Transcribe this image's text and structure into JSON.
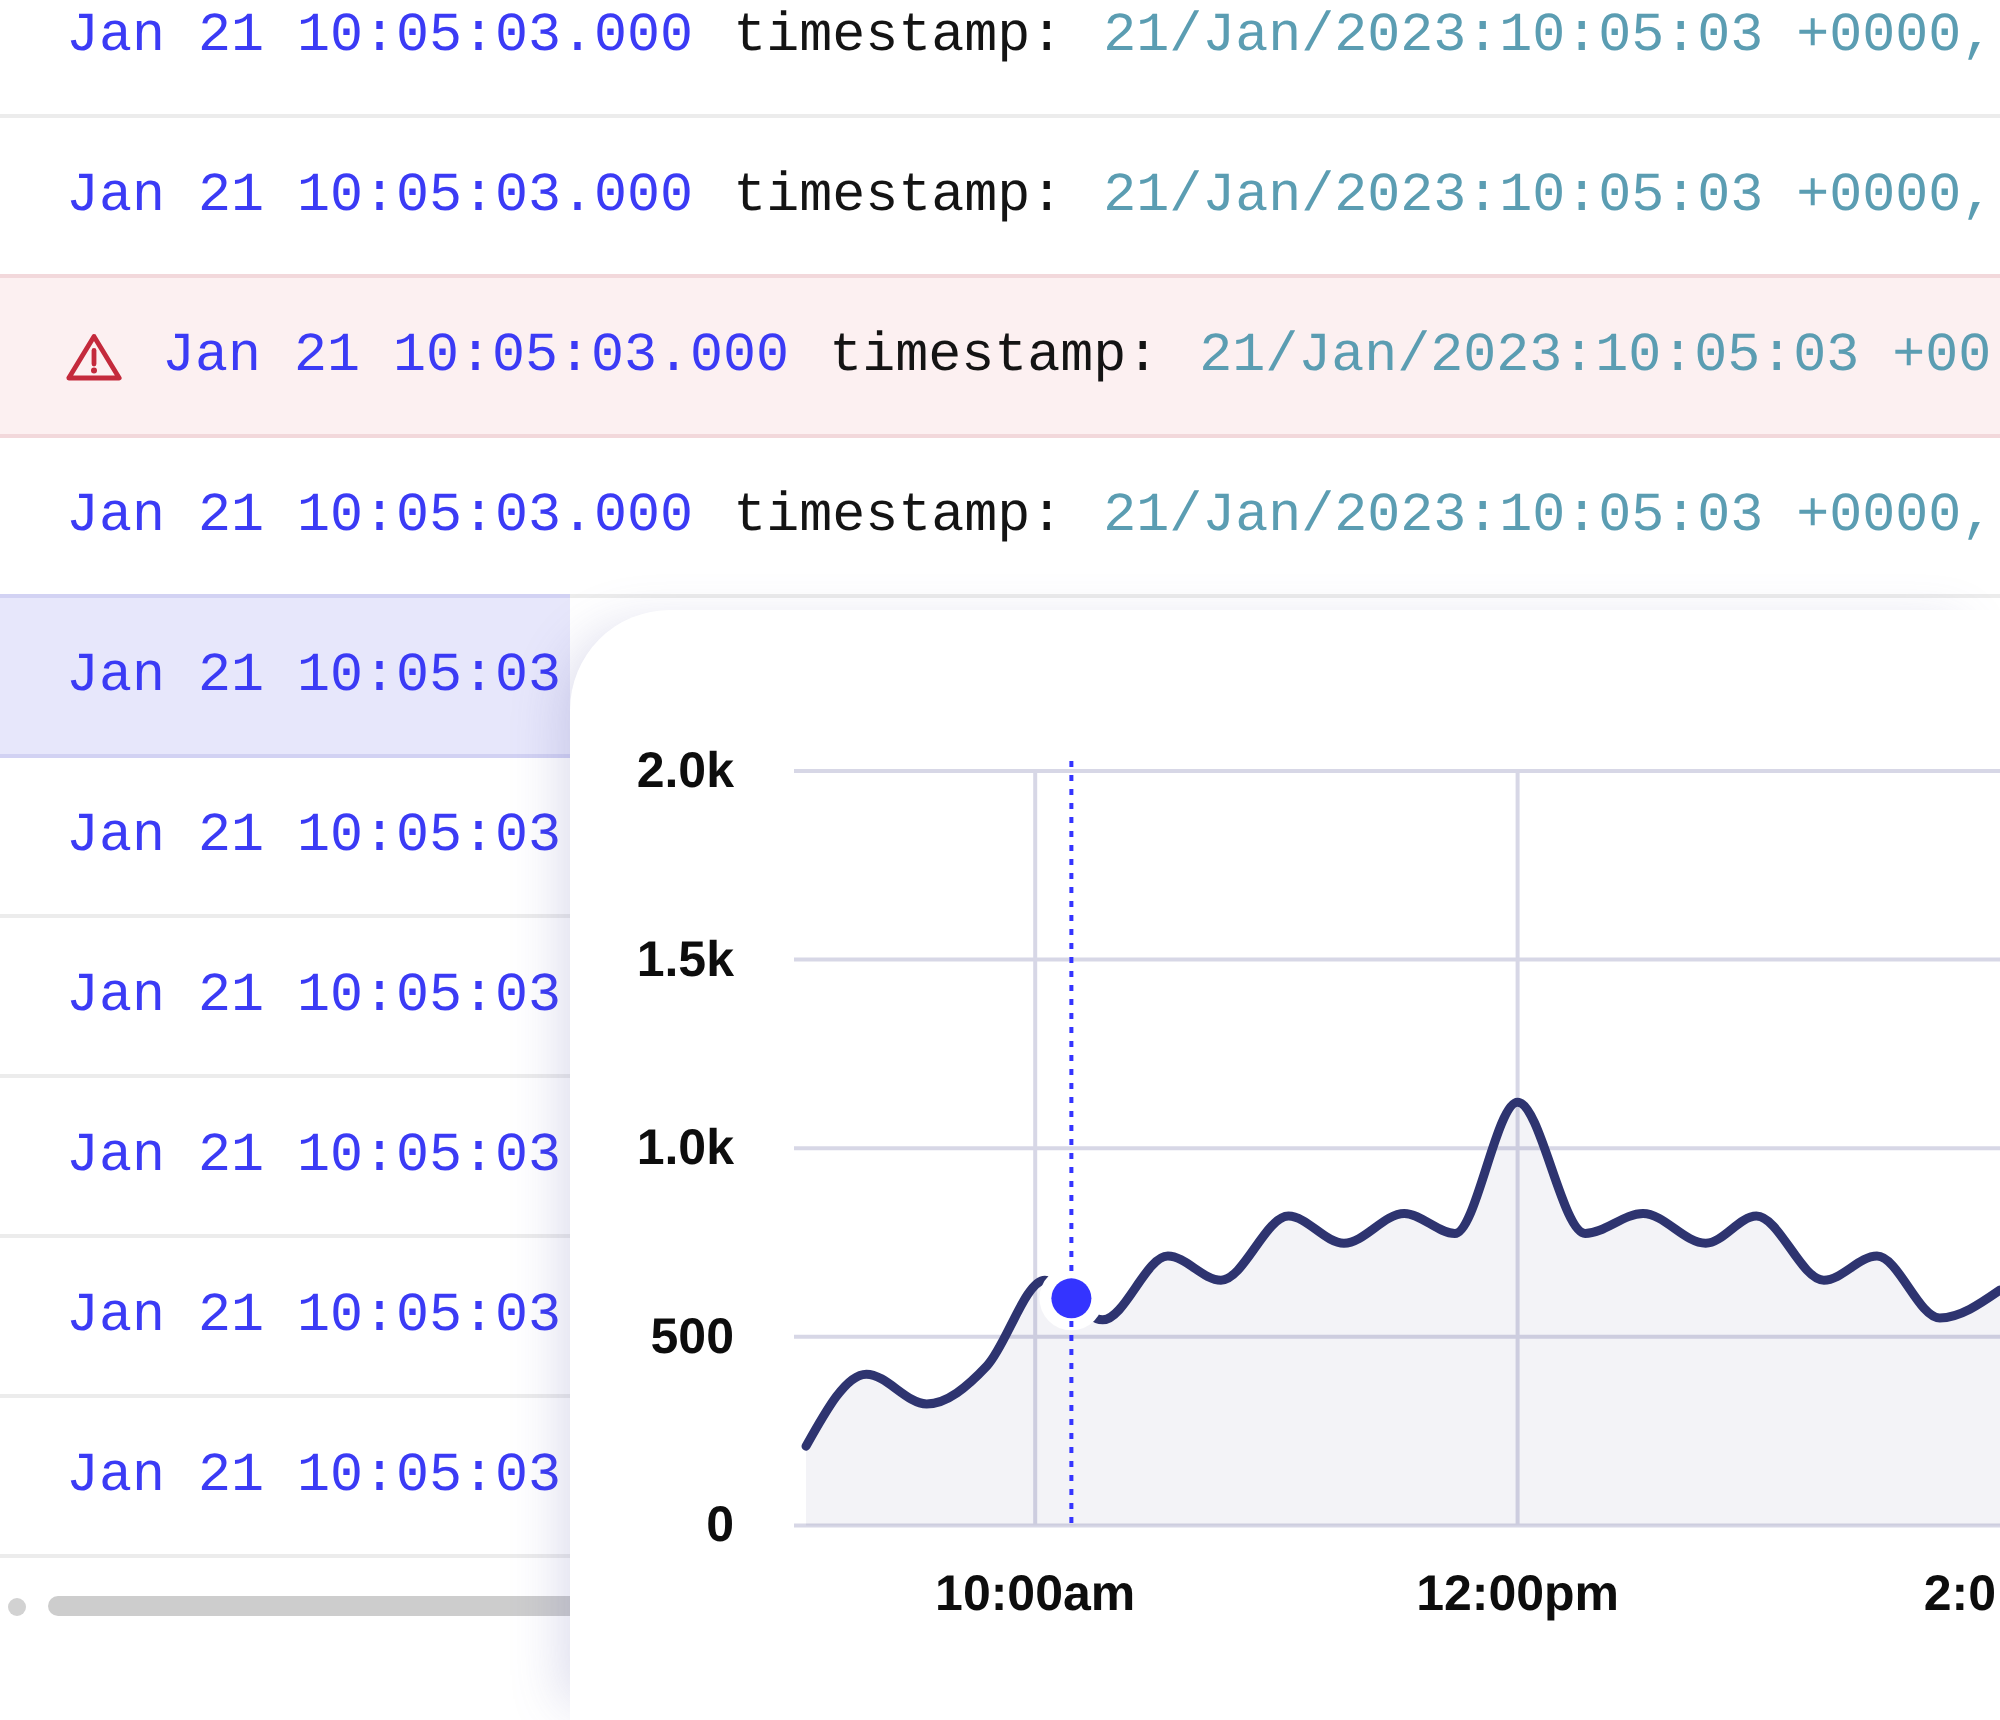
{
  "log": {
    "rows": [
      {
        "time": "Jan 21 10:05:03.000",
        "key": "timestamp:",
        "value": "21/Jan/2023:10:05:03 +0000,",
        "kind": "normal",
        "selected": false
      },
      {
        "time": "Jan 21 10:05:03.000",
        "key": "timestamp:",
        "value": "21/Jan/2023:10:05:03 +0000,",
        "kind": "normal",
        "selected": false
      },
      {
        "time": "Jan 21 10:05:03.000",
        "key": "timestamp:",
        "value": "21/Jan/2023:10:05:03 +00",
        "kind": "warning",
        "selected": false
      },
      {
        "time": "Jan 21 10:05:03.000",
        "key": "timestamp:",
        "value": "21/Jan/2023:10:05:03 +0000,",
        "kind": "normal",
        "selected": false
      },
      {
        "time": "Jan 21 10:05:03",
        "kind": "normal",
        "selected": true
      },
      {
        "time": "Jan 21 10:05:03",
        "kind": "normal",
        "selected": false
      },
      {
        "time": "Jan 21 10:05:03",
        "kind": "normal",
        "selected": false
      },
      {
        "time": "Jan 21 10:05:03",
        "kind": "normal",
        "selected": false
      },
      {
        "time": "Jan 21 10:05:03",
        "kind": "normal",
        "selected": false
      },
      {
        "time": "Jan 21 10:05:03",
        "kind": "normal",
        "selected": false
      }
    ]
  },
  "chart_panel": {
    "chart_data": {
      "type": "area",
      "x": [
        9.05,
        9.3,
        9.55,
        9.8,
        10.04,
        10.28,
        10.55,
        10.77,
        11.05,
        11.28,
        11.53,
        11.74,
        12.0,
        12.28,
        12.52,
        12.78,
        12.99,
        13.27,
        13.49,
        13.75,
        14.0
      ],
      "series": [
        {
          "color": "#2e3470",
          "values": [
            210,
            401,
            322,
            423,
            650,
            545,
            714,
            650,
            820,
            748,
            827,
            774,
            1122,
            774,
            827,
            748,
            820,
            650,
            714,
            550,
            624
          ]
        }
      ],
      "xlim": [
        9,
        14
      ],
      "ylim": [
        0,
        2000
      ],
      "xticks": [
        {
          "value": 10,
          "label": "10:00am"
        },
        {
          "value": 12,
          "label": "12:00pm"
        },
        {
          "value": 14,
          "label": "2:0"
        }
      ],
      "yticks": [
        0,
        500,
        {
          "value": 1000,
          "label": "1.0k"
        },
        {
          "value": 1500,
          "label": "1.5k"
        },
        {
          "value": 2000,
          "label": "2.0k"
        }
      ],
      "grid": true,
      "ref_lines": [
        {
          "axis": "x",
          "value": 10.15
        }
      ]
    }
  }
}
